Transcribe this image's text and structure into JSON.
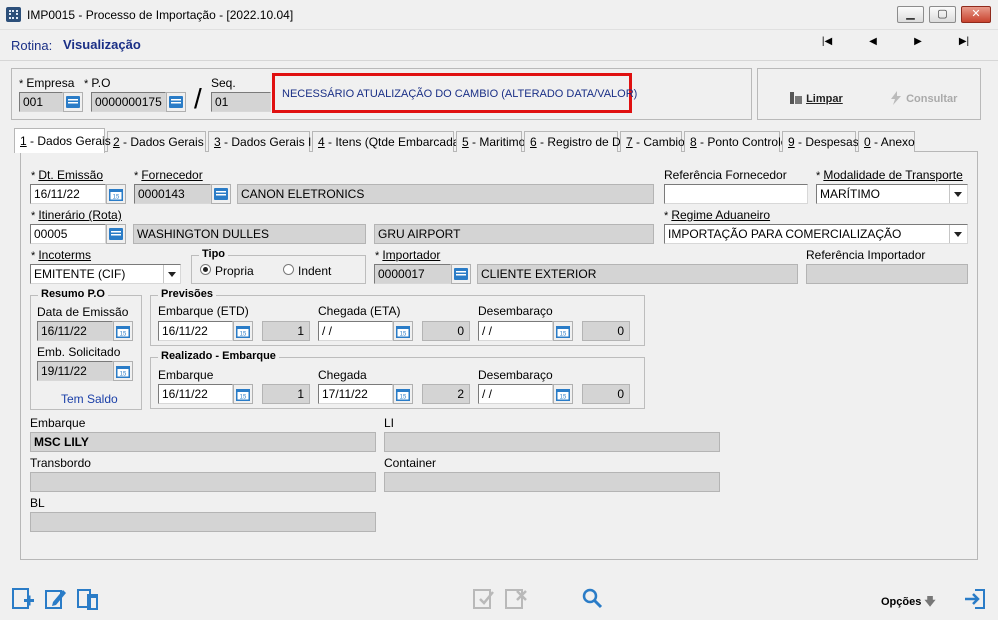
{
  "window": {
    "title": "IMP0015 - Processo de Importação - [2022.10.04]"
  },
  "rotina": {
    "label": "Rotina:",
    "value": "Visualização"
  },
  "nav": {
    "first": "|◀",
    "prev": "◀",
    "next": "▶",
    "last": "▶|"
  },
  "header": {
    "empresa": {
      "label": "Empresa",
      "value": "001"
    },
    "po": {
      "label": "P.O",
      "value": "0000000175"
    },
    "seq": {
      "label": "Seq.",
      "value": "01"
    },
    "separator": "/",
    "alert": "NECESSÁRIO ATUALIZAÇÃO DO CAMBIO (ALTERADO DATA/VALOR)",
    "limpar": "Limpar",
    "consultar": "Consultar"
  },
  "tabs": [
    {
      "key": "1",
      "label": " - Dados Gerais",
      "active": true
    },
    {
      "key": "2",
      "label": " - Dados Gerais II"
    },
    {
      "key": "3",
      "label": " - Dados Gerais III"
    },
    {
      "key": "4",
      "label": " - Itens (Qtde Embarcada)"
    },
    {
      "key": "5",
      "label": " - Maritimo"
    },
    {
      "key": "6",
      "label": " - Registro de DI"
    },
    {
      "key": "7",
      "label": " - Cambio"
    },
    {
      "key": "8",
      "label": " - Ponto Controle"
    },
    {
      "key": "9",
      "label": " - Despesas"
    },
    {
      "key": "0",
      "label": " - Anexo"
    }
  ],
  "form": {
    "dt_emissao": {
      "label": "Dt. Emissão",
      "value": "16/11/22"
    },
    "fornecedor": {
      "label": "Fornecedor",
      "code": "0000143",
      "name": "CANON ELETRONICS"
    },
    "ref_fornecedor": {
      "label": "Referência Fornecedor",
      "value": ""
    },
    "modalidade": {
      "label": "Modalidade de Transporte",
      "value": "MARÍTIMO"
    },
    "itinerario": {
      "label": "Itinerário (Rota)",
      "code": "00005",
      "origem": "WASHINGTON DULLES",
      "destino": "GRU AIRPORT"
    },
    "regime": {
      "label": "Regime Aduaneiro",
      "value": "IMPORTAÇÃO PARA COMERCIALIZAÇÃO"
    },
    "incoterms": {
      "label": "Incoterms",
      "value": "EMITENTE (CIF)"
    },
    "tipo": {
      "label": "Tipo",
      "opt1": "Propria",
      "opt2": "Indent",
      "selected": "Propria"
    },
    "importador": {
      "label": "Importador",
      "code": "0000017",
      "name": "CLIENTE EXTERIOR"
    },
    "ref_importador": {
      "label": "Referência Importador",
      "value": ""
    },
    "resumo": {
      "title": "Resumo P.O",
      "data_emissao_label": "Data de Emissão",
      "data_emissao": "16/11/22",
      "emb_solicitado_label": "Emb. Solicitado",
      "emb_solicitado": "19/11/22",
      "saldo": "Tem Saldo"
    },
    "previsoes": {
      "title": "Previsões",
      "embarque_label": "Embarque (ETD)",
      "embarque": "16/11/22",
      "embarque_n": "1",
      "chegada_label": "Chegada (ETA)",
      "chegada": " / /",
      "chegada_n": "0",
      "desembaraco_label": "Desembaraço",
      "desembaraco": " / /",
      "desembaraco_n": "0"
    },
    "realizado": {
      "title": "Realizado - Embarque",
      "embarque_label": "Embarque",
      "embarque": "16/11/22",
      "embarque_n": "1",
      "chegada_label": "Chegada",
      "chegada": "17/11/22",
      "chegada_n": "2",
      "desembaraco_label": "Desembaraço",
      "desembaraco": " / /",
      "desembaraco_n": "0"
    },
    "embarque": {
      "label": "Embarque",
      "value": "MSC LILY"
    },
    "li": {
      "label": "LI",
      "value": ""
    },
    "transbordo": {
      "label": "Transbordo",
      "value": ""
    },
    "container": {
      "label": "Container",
      "value": ""
    },
    "bl": {
      "label": "BL",
      "value": ""
    }
  },
  "bottom": {
    "opcoes": "Opções"
  },
  "colors": {
    "accent": "#1a2f86",
    "alert_border": "#e01010",
    "icon_blue": "#2a7cc7"
  }
}
